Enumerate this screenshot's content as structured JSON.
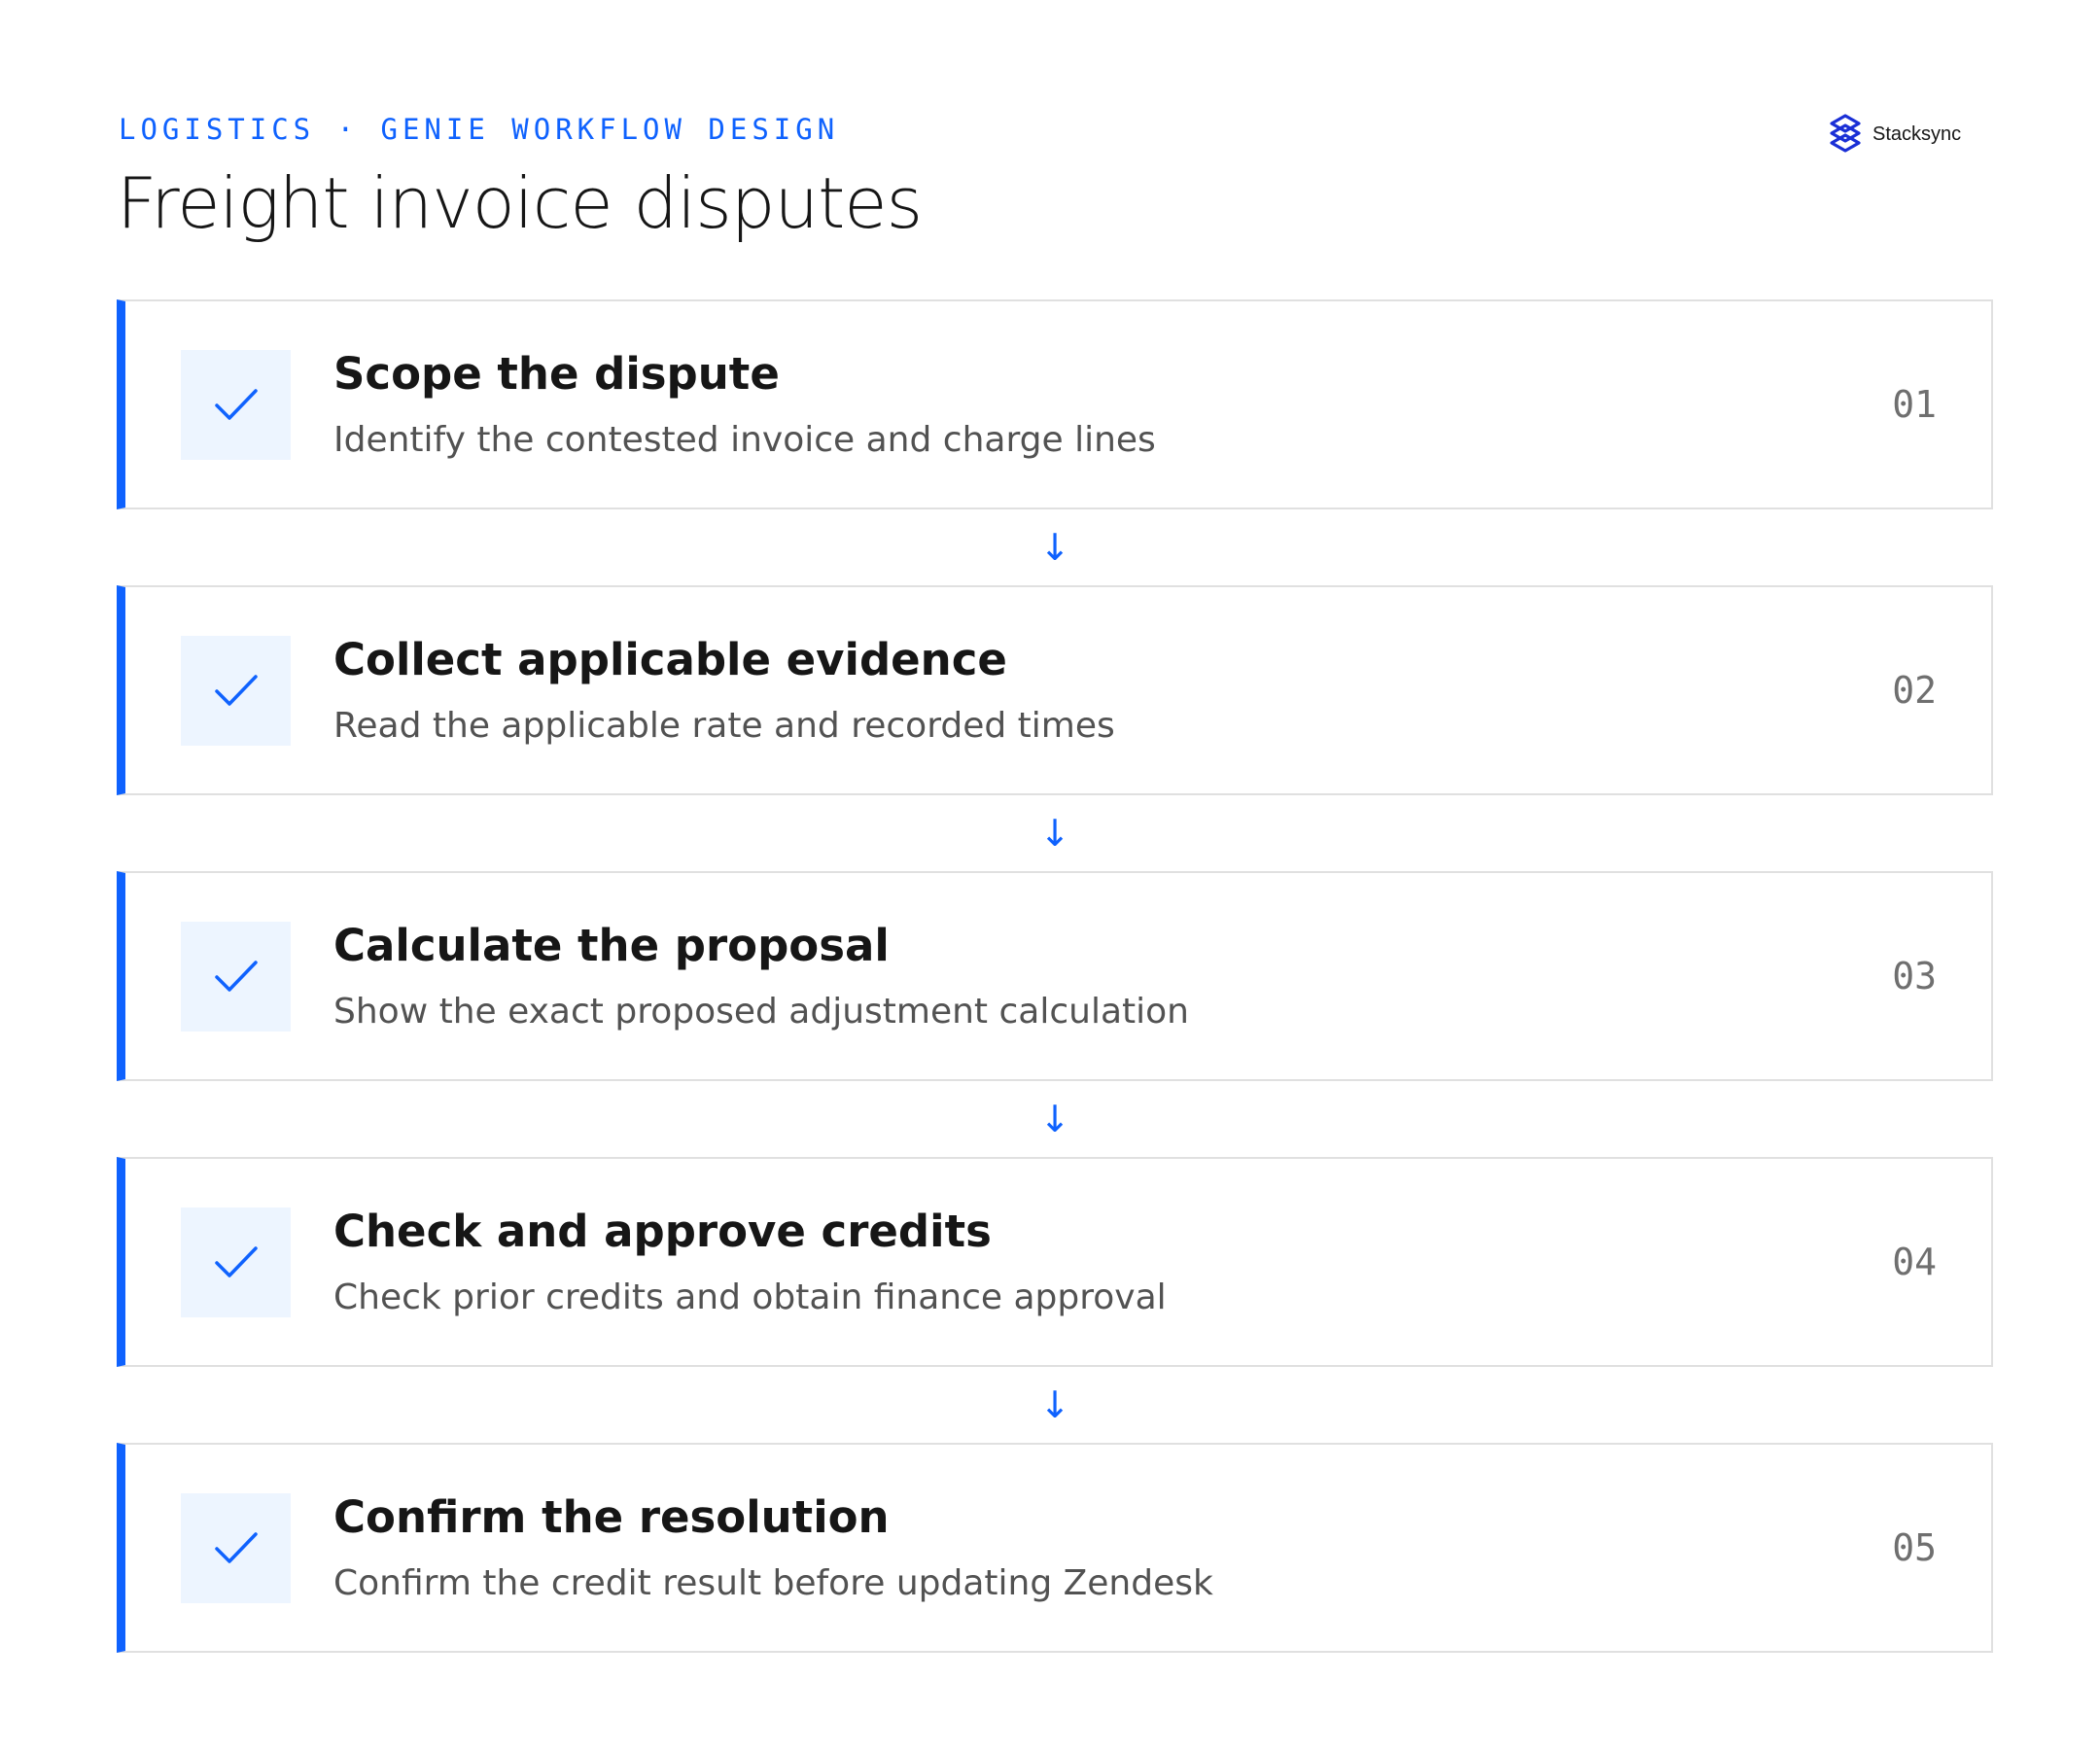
{
  "header": {
    "eyebrow": "LOGISTICS · GENIE WORKFLOW DESIGN",
    "title": "Freight invoice disputes"
  },
  "logo": {
    "name": "Stacksync",
    "icon": "stacksync-logo-icon"
  },
  "colors": {
    "accent": "#0f62fe",
    "check_bg": "#edf5ff",
    "border": "#e0e0e0",
    "title_text": "#161616",
    "desc_text": "#525252",
    "number_text": "#6f6f6f"
  },
  "connector_glyph": "↓",
  "steps": [
    {
      "number": "01",
      "title": "Scope the dispute",
      "description": "Identify the contested invoice and charge lines",
      "status_icon": "checkmark-icon"
    },
    {
      "number": "02",
      "title": "Collect applicable evidence",
      "description": "Read the applicable rate and recorded times",
      "status_icon": "checkmark-icon"
    },
    {
      "number": "03",
      "title": "Calculate the proposal",
      "description": "Show the exact proposed adjustment calculation",
      "status_icon": "checkmark-icon"
    },
    {
      "number": "04",
      "title": "Check and approve credits",
      "description": "Check prior credits and obtain finance approval",
      "status_icon": "checkmark-icon"
    },
    {
      "number": "05",
      "title": "Confirm the resolution",
      "description": "Confirm the credit result before updating Zendesk",
      "status_icon": "checkmark-icon"
    }
  ]
}
